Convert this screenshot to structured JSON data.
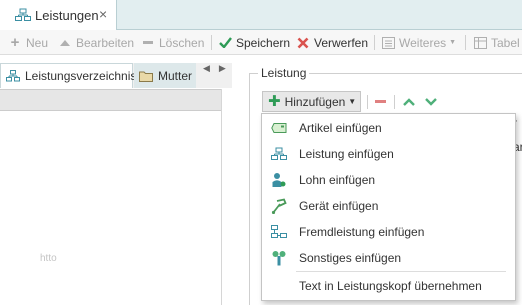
{
  "tab": {
    "label": "Leistungen",
    "close": "×"
  },
  "toolbar": {
    "new": "Neu",
    "edit": "Bearbeiten",
    "delete": "Löschen",
    "save": "Speichern",
    "discard": "Verwerfen",
    "more": "Weiteres",
    "table": "Tabel"
  },
  "left": {
    "tab_catalog": "Leistungsverzeichnis",
    "tab_parent": "Mutter",
    "ghost_text": "htto"
  },
  "right": {
    "group_title": "Leistung",
    "add_button": "Hinzufügen",
    "grid_edge_top": "r",
    "grid_edge_bottom": "ar"
  },
  "menu": {
    "items": [
      {
        "label": "Artikel einfügen",
        "icon": "article-icon"
      },
      {
        "label": "Leistung einfügen",
        "icon": "service-icon"
      },
      {
        "label": "Lohn einfügen",
        "icon": "wage-icon"
      },
      {
        "label": "Gerät einfügen",
        "icon": "device-icon"
      },
      {
        "label": "Fremdleistung einfügen",
        "icon": "external-service-icon"
      },
      {
        "label": "Sonstiges einfügen",
        "icon": "misc-icon"
      },
      {
        "label": "Text in Leistungskopf übernehmen",
        "icon": ""
      }
    ]
  },
  "colors": {
    "accent_green": "#2e9b56",
    "delete_red": "#d9534f",
    "tab_strip": "#e2eef0"
  }
}
